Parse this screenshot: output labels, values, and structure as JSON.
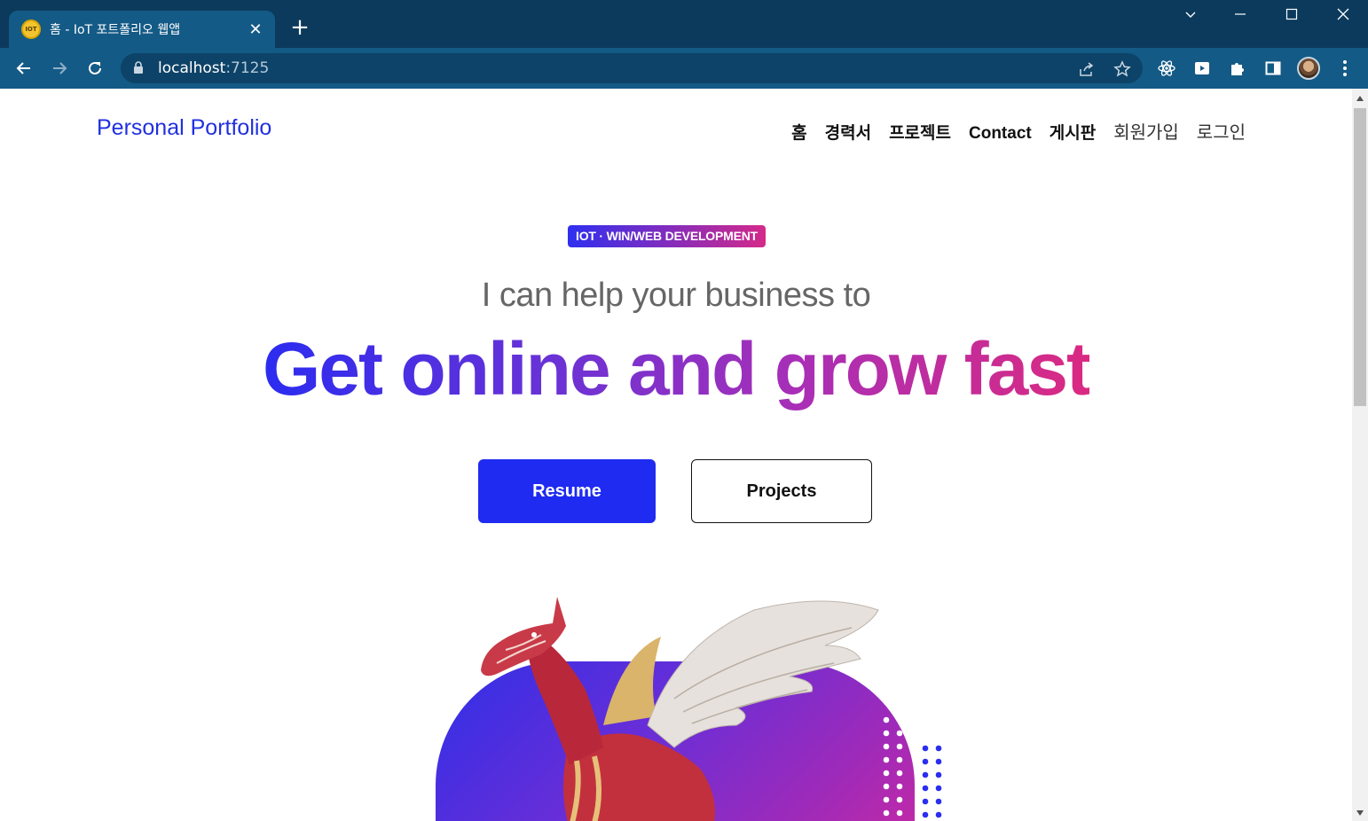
{
  "browser": {
    "tab_title": "홈 - IoT 포트폴리오 웹앱",
    "favicon_text": "IOT",
    "url_host": "localhost",
    "url_port": ":7125"
  },
  "page": {
    "brand": "Personal Portfolio",
    "nav": [
      "홈",
      "경력서",
      "프로젝트",
      "Contact",
      "게시판",
      "회원가입",
      "로그인"
    ],
    "badge": "IOT · WIN/WEB DEVELOPMENT",
    "subtitle": "I can help your business to",
    "headline": "Get online and grow fast",
    "buttons": {
      "primary": "Resume",
      "secondary": "Projects"
    },
    "colors": {
      "brand_blue": "#2130e0",
      "gradient_start": "#2b2cf0",
      "gradient_end": "#da2a82"
    }
  }
}
